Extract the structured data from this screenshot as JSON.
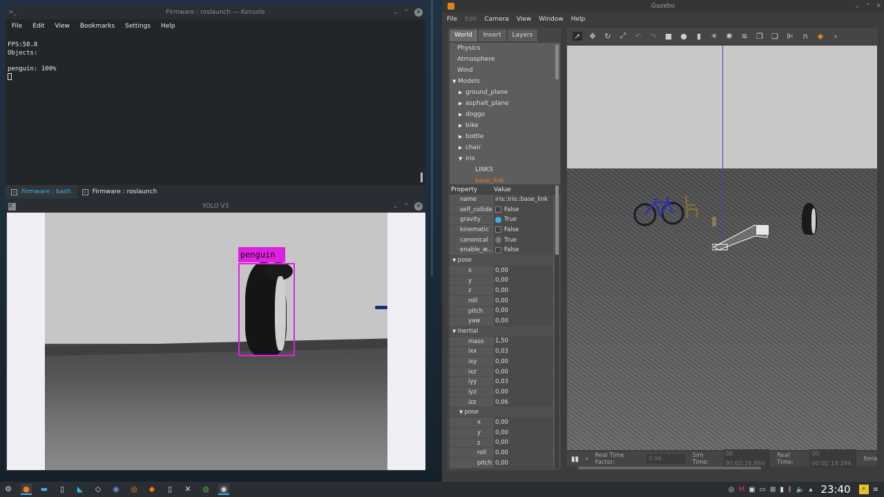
{
  "konsole": {
    "title": "Firmware : roslaunch — Konsole",
    "menu": [
      "File",
      "Edit",
      "View",
      "Bookmarks",
      "Settings",
      "Help"
    ],
    "lines": [
      "FPS:58.8",
      "Objects:",
      "",
      "penguin: 100%"
    ],
    "tabs": [
      {
        "label": "Firmware : bash",
        "active": true
      },
      {
        "label": "Firmware : roslaunch",
        "active": false
      }
    ]
  },
  "yolo": {
    "title": "YOLO V3",
    "detection_label": "penguin"
  },
  "gazebo": {
    "title": "Gazebo",
    "menu": [
      "File",
      "Edit",
      "Camera",
      "View",
      "Window",
      "Help"
    ],
    "menu_disabled": [
      "Edit"
    ],
    "tabs": [
      "World",
      "Insert",
      "Layers"
    ],
    "tree": [
      {
        "label": "Physics",
        "indent": 1,
        "arrow": ""
      },
      {
        "label": "Atmosphere",
        "indent": 1,
        "arrow": ""
      },
      {
        "label": "Wind",
        "indent": 1,
        "arrow": ""
      },
      {
        "label": "Models",
        "indent": 0,
        "arrow": "down"
      },
      {
        "label": "ground_plane",
        "indent": 2,
        "arrow": "right"
      },
      {
        "label": "asphalt_plane",
        "indent": 2,
        "arrow": "right"
      },
      {
        "label": "doggo",
        "indent": 2,
        "arrow": "right"
      },
      {
        "label": "bike",
        "indent": 2,
        "arrow": "right"
      },
      {
        "label": "bottle",
        "indent": 2,
        "arrow": "right"
      },
      {
        "label": "chair",
        "indent": 2,
        "arrow": "right"
      },
      {
        "label": "iris",
        "indent": 2,
        "arrow": "down"
      },
      {
        "label": "LINKS",
        "indent": 3,
        "arrow": ""
      },
      {
        "label": "base_link",
        "indent": 3,
        "arrow": "",
        "selected": true
      }
    ],
    "props_header": {
      "property": "Property",
      "value": "Value"
    },
    "props": [
      {
        "k": "name",
        "v": "iris::iris::base_link",
        "type": "text"
      },
      {
        "k": "self_collide",
        "v": "False",
        "type": "check"
      },
      {
        "k": "gravity",
        "v": "True",
        "type": "on"
      },
      {
        "k": "kinematic",
        "v": "False",
        "type": "check"
      },
      {
        "k": "canonical",
        "v": "True",
        "type": "half"
      },
      {
        "k": "enable_w...",
        "v": "False",
        "type": "check"
      },
      {
        "k": "pose",
        "v": "",
        "type": "group"
      },
      {
        "k": "x",
        "v": "0,00",
        "type": "text",
        "ind": 2
      },
      {
        "k": "y",
        "v": "0,00",
        "type": "text",
        "ind": 2
      },
      {
        "k": "z",
        "v": "0,00",
        "type": "text",
        "ind": 2
      },
      {
        "k": "roll",
        "v": "0,00",
        "type": "text",
        "ind": 2
      },
      {
        "k": "pitch",
        "v": "0,00",
        "type": "text",
        "ind": 2
      },
      {
        "k": "yaw",
        "v": "0,00",
        "type": "text",
        "ind": 2
      },
      {
        "k": "inertial",
        "v": "",
        "type": "group"
      },
      {
        "k": "mass",
        "v": "1,50",
        "type": "text",
        "ind": 2
      },
      {
        "k": "ixx",
        "v": "0,03",
        "type": "text",
        "ind": 2
      },
      {
        "k": "ixy",
        "v": "0,00",
        "type": "text",
        "ind": 2
      },
      {
        "k": "ixz",
        "v": "0,00",
        "type": "text",
        "ind": 2
      },
      {
        "k": "iyy",
        "v": "0,03",
        "type": "text",
        "ind": 2
      },
      {
        "k": "iyz",
        "v": "0,00",
        "type": "text",
        "ind": 2
      },
      {
        "k": "izz",
        "v": "0,06",
        "type": "text",
        "ind": 2
      },
      {
        "k": "pose",
        "v": "",
        "type": "subgroup"
      },
      {
        "k": "x",
        "v": "0,00",
        "type": "text",
        "ind": 3
      },
      {
        "k": "y",
        "v": "0,00",
        "type": "text",
        "ind": 3
      },
      {
        "k": "z",
        "v": "0,00",
        "type": "text",
        "ind": 3
      },
      {
        "k": "roll",
        "v": "0,00",
        "type": "text",
        "ind": 3
      },
      {
        "k": "pitch",
        "v": "0,00",
        "type": "text",
        "ind": 3
      }
    ],
    "status": {
      "rtf_label": "Real Time Factor:",
      "rtf_value": "0.96",
      "sim_label": "Sim Time:",
      "sim_value": "00 00:02:16.860",
      "real_label": "Real Time:",
      "real_value": "00 00:02:19.294",
      "iter_label": "Itera"
    }
  },
  "taskbar": {
    "clock": "23:40"
  },
  "colors": {
    "accent": "#3daee9",
    "bbox": "#e020e0",
    "gazebo_selected": "#e08020"
  }
}
